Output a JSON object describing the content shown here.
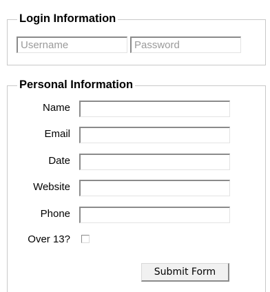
{
  "login": {
    "legend": "Login Information",
    "username_placeholder": "Username",
    "password_placeholder": "Password"
  },
  "personal": {
    "legend": "Personal Information",
    "fields": [
      {
        "label": "Name"
      },
      {
        "label": "Email"
      },
      {
        "label": "Date"
      },
      {
        "label": "Website"
      },
      {
        "label": "Phone"
      }
    ],
    "over13_label": "Over 13?",
    "submit_label": "Submit Form"
  }
}
